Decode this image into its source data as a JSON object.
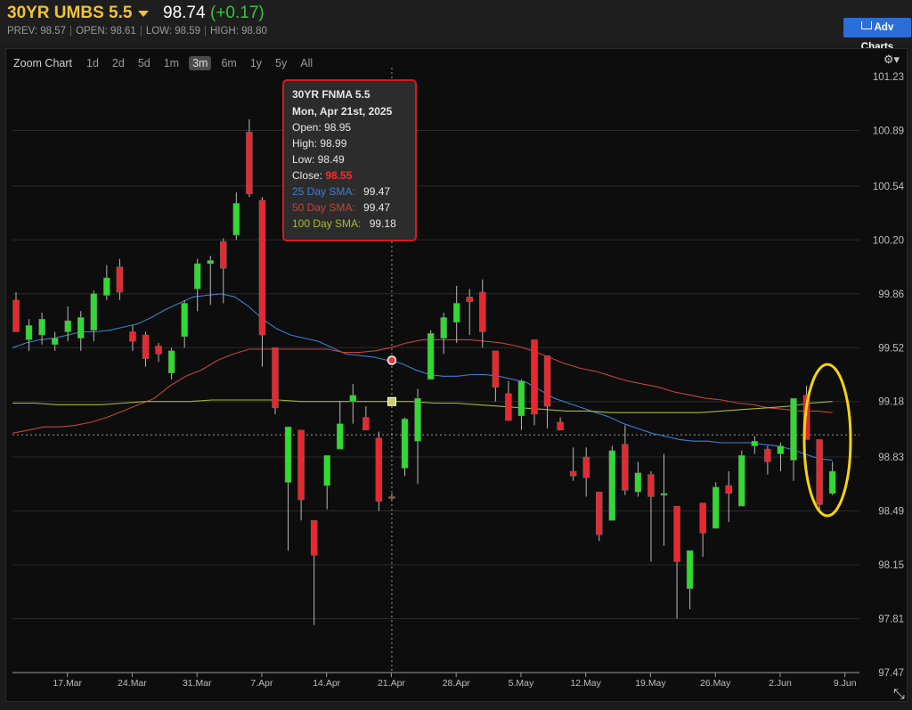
{
  "header": {
    "title": "30YR UMBS 5.5",
    "price": "98.74",
    "change": "(+0.17)",
    "prev": "PREV: 98.57",
    "open": "OPEN: 98.61",
    "low": "LOW: 98.59",
    "high": "HIGH: 98.80",
    "adv_charts_label": "Adv Charts"
  },
  "toolbar": {
    "zoom_label": "Zoom Chart",
    "ranges": [
      "1d",
      "2d",
      "5d",
      "1m",
      "3m",
      "6m",
      "1y",
      "5y",
      "All"
    ],
    "active_range": "3m",
    "settings_icon": "gear-icon"
  },
  "tooltip": {
    "instrument": "30YR FNMA 5.5",
    "date": "Mon, Apr 21st, 2025",
    "open": "Open: 98.95",
    "high": "High: 98.99",
    "low": "Low: 98.49",
    "close_label": "Close:",
    "close_value": "98.55",
    "sma25_label": "25 Day SMA:",
    "sma25_value": "99.47",
    "sma50_label": "50 Day SMA:",
    "sma50_value": "99.47",
    "sma100_label": "100 Day SMA:",
    "sma100_value": "99.18"
  },
  "colors": {
    "up": "#2fdb2f",
    "down": "#e8282e",
    "sma25": "#3d7fcf",
    "sma50": "#c0443e",
    "sma100": "#a9b83a",
    "highlight_ellipse": "#f5d40f",
    "title": "#f0c23c"
  },
  "chart_data": {
    "type": "candlestick",
    "y_ticks": [
      "101.23",
      "100.89",
      "100.54",
      "100.20",
      "99.86",
      "99.52",
      "99.18",
      "98.83",
      "98.49",
      "98.15",
      "97.81",
      "97.47"
    ],
    "x_ticks": [
      "17.Mar",
      "24.Mar",
      "31.Mar",
      "7.Apr",
      "14.Apr",
      "21.Apr",
      "28.Apr",
      "5.May",
      "12.May",
      "19.May",
      "26.May",
      "2.Jun",
      "9.Jun"
    ],
    "ylim": [
      97.47,
      101.23
    ],
    "grid": true,
    "crosshair_value": 98.97,
    "candles": [
      {
        "open": 99.82,
        "close": 99.62,
        "high": 99.87,
        "low": 99.62
      },
      {
        "open": 99.57,
        "close": 99.66,
        "high": 99.7,
        "low": 99.5
      },
      {
        "open": 99.6,
        "close": 99.7,
        "high": 99.74,
        "low": 99.54
      },
      {
        "open": 99.54,
        "close": 99.58,
        "high": 99.62,
        "low": 99.5
      },
      {
        "open": 99.62,
        "close": 99.69,
        "high": 99.78,
        "low": 99.56
      },
      {
        "open": 99.58,
        "close": 99.71,
        "high": 99.75,
        "low": 99.5
      },
      {
        "open": 99.63,
        "close": 99.86,
        "high": 99.88,
        "low": 99.56
      },
      {
        "open": 99.85,
        "close": 99.96,
        "high": 100.04,
        "low": 99.82
      },
      {
        "open": 100.03,
        "close": 99.87,
        "high": 100.08,
        "low": 99.82
      },
      {
        "open": 99.62,
        "close": 99.56,
        "high": 99.66,
        "low": 99.5
      },
      {
        "open": 99.6,
        "close": 99.45,
        "high": 99.62,
        "low": 99.4
      },
      {
        "open": 99.53,
        "close": 99.48,
        "high": 99.55,
        "low": 99.43
      },
      {
        "open": 99.36,
        "close": 99.5,
        "high": 99.52,
        "low": 99.32
      },
      {
        "open": 99.59,
        "close": 99.8,
        "high": 99.82,
        "low": 99.52
      },
      {
        "open": 99.89,
        "close": 100.05,
        "high": 100.08,
        "low": 99.75
      },
      {
        "open": 100.05,
        "close": 100.07,
        "high": 100.1,
        "low": 99.79
      },
      {
        "open": 100.19,
        "close": 100.02,
        "high": 100.21,
        "low": 99.8
      },
      {
        "open": 100.23,
        "close": 100.43,
        "high": 100.5,
        "low": 100.2
      },
      {
        "open": 100.88,
        "close": 100.49,
        "high": 100.96,
        "low": 100.47
      },
      {
        "open": 100.45,
        "close": 99.6,
        "high": 100.47,
        "low": 99.4
      },
      {
        "open": 99.52,
        "close": 99.14,
        "high": 99.52,
        "low": 99.1
      },
      {
        "open": 98.67,
        "close": 99.02,
        "high": 99.02,
        "low": 98.24
      },
      {
        "open": 99.0,
        "close": 98.56,
        "high": 99.0,
        "low": 98.43
      },
      {
        "open": 98.43,
        "close": 98.21,
        "high": 98.43,
        "low": 97.77
      },
      {
        "open": 98.65,
        "close": 98.84,
        "high": 98.84,
        "low": 98.5
      },
      {
        "open": 98.88,
        "close": 99.04,
        "high": 99.18,
        "low": 98.88
      },
      {
        "open": 99.18,
        "close": 99.22,
        "high": 99.29,
        "low": 99.04
      },
      {
        "open": 99.08,
        "close": 99.0,
        "high": 99.15,
        "low": 99.0
      },
      {
        "open": 98.95,
        "close": 98.55,
        "high": 98.99,
        "low": 98.49
      },
      {
        "open": 98.58,
        "close": 98.57,
        "high": 98.6,
        "low": 98.56
      },
      {
        "open": 98.76,
        "close": 99.07,
        "high": 99.08,
        "low": 98.71
      },
      {
        "open": 98.93,
        "close": 99.2,
        "high": 99.26,
        "low": 98.66
      },
      {
        "open": 99.32,
        "close": 99.61,
        "high": 99.63,
        "low": 99.32
      },
      {
        "open": 99.58,
        "close": 99.71,
        "high": 99.74,
        "low": 99.48
      },
      {
        "open": 99.68,
        "close": 99.8,
        "high": 99.91,
        "low": 99.55
      },
      {
        "open": 99.84,
        "close": 99.81,
        "high": 99.89,
        "low": 99.6
      },
      {
        "open": 99.87,
        "close": 99.62,
        "high": 99.95,
        "low": 99.52
      },
      {
        "open": 99.5,
        "close": 99.27,
        "high": 99.5,
        "low": 99.18
      },
      {
        "open": 99.23,
        "close": 99.06,
        "high": 99.31,
        "low": 99.06
      },
      {
        "open": 99.09,
        "close": 99.31,
        "high": 99.32,
        "low": 99.0
      },
      {
        "open": 99.57,
        "close": 99.1,
        "high": 99.57,
        "low": 99.03
      },
      {
        "open": 99.47,
        "close": 99.15,
        "high": 99.47,
        "low": 99.01
      },
      {
        "open": 99.05,
        "close": 99.0,
        "high": 99.08,
        "low": 99.0
      },
      {
        "open": 98.74,
        "close": 98.71,
        "high": 98.89,
        "low": 98.68
      },
      {
        "open": 98.83,
        "close": 98.7,
        "high": 98.89,
        "low": 98.58
      },
      {
        "open": 98.61,
        "close": 98.34,
        "high": 98.61,
        "low": 98.3
      },
      {
        "open": 98.43,
        "close": 98.87,
        "high": 98.9,
        "low": 98.43
      },
      {
        "open": 98.91,
        "close": 98.62,
        "high": 99.03,
        "low": 98.59
      },
      {
        "open": 98.61,
        "close": 98.73,
        "high": 98.8,
        "low": 98.58
      },
      {
        "open": 98.72,
        "close": 98.58,
        "high": 98.74,
        "low": 98.17
      },
      {
        "open": 98.59,
        "close": 98.6,
        "high": 98.85,
        "low": 98.27
      },
      {
        "open": 98.52,
        "close": 98.17,
        "high": 98.52,
        "low": 97.81
      },
      {
        "open": 98.0,
        "close": 98.24,
        "high": 98.24,
        "low": 97.87
      },
      {
        "open": 98.54,
        "close": 98.35,
        "high": 98.54,
        "low": 98.2
      },
      {
        "open": 98.38,
        "close": 98.64,
        "high": 98.67,
        "low": 98.38
      },
      {
        "open": 98.65,
        "close": 98.6,
        "high": 98.74,
        "low": 98.42
      },
      {
        "open": 98.52,
        "close": 98.84,
        "high": 98.87,
        "low": 98.52
      },
      {
        "open": 98.9,
        "close": 98.93,
        "high": 98.96,
        "low": 98.85
      },
      {
        "open": 98.88,
        "close": 98.8,
        "high": 98.9,
        "low": 98.72
      },
      {
        "open": 98.85,
        "close": 98.9,
        "high": 98.92,
        "low": 98.74
      },
      {
        "open": 98.81,
        "close": 99.2,
        "high": 99.2,
        "low": 98.68
      },
      {
        "open": 99.22,
        "close": 98.94,
        "high": 99.28,
        "low": 98.94
      },
      {
        "open": 98.94,
        "close": 98.53,
        "high": 98.94,
        "low": 98.49
      },
      {
        "open": 98.6,
        "close": 98.74,
        "high": 98.8,
        "low": 98.59
      }
    ],
    "series": [
      {
        "name": "25 Day SMA",
        "values": [
          99.52,
          99.55,
          99.57,
          99.58,
          99.6,
          99.62,
          99.62,
          99.63,
          99.65,
          99.67,
          99.71,
          99.76,
          99.8,
          99.84,
          99.85,
          99.86,
          99.84,
          99.78,
          99.7,
          99.64,
          99.6,
          99.58,
          99.56,
          99.52,
          99.48,
          99.47,
          99.46,
          99.44,
          99.42,
          99.38,
          99.35,
          99.34,
          99.34,
          99.35,
          99.35,
          99.34,
          99.32,
          99.3,
          99.25,
          99.2,
          99.17,
          99.14,
          99.11,
          99.08,
          99.04,
          99.01,
          98.98,
          98.96,
          98.94,
          98.93,
          98.93,
          98.92,
          98.92,
          98.92,
          98.91,
          98.9,
          98.88,
          98.85,
          98.82,
          98.81
        ]
      },
      {
        "name": "50 Day SMA",
        "values": [
          98.98,
          99.0,
          99.02,
          99.02,
          99.03,
          99.05,
          99.08,
          99.12,
          99.16,
          99.2,
          99.28,
          99.34,
          99.38,
          99.44,
          99.48,
          99.51,
          99.51,
          99.51,
          99.51,
          99.51,
          99.51,
          99.49,
          99.49,
          99.5,
          99.52,
          99.55,
          99.57,
          99.57,
          99.57,
          99.57,
          99.56,
          99.55,
          99.53,
          99.5,
          99.46,
          99.42,
          99.39,
          99.37,
          99.34,
          99.31,
          99.29,
          99.27,
          99.24,
          99.22,
          99.2,
          99.19,
          99.17,
          99.16,
          99.14,
          99.13,
          99.12,
          99.12,
          99.11
        ]
      },
      {
        "name": "100 Day SMA",
        "values": [
          99.17,
          99.17,
          99.16,
          99.16,
          99.16,
          99.17,
          99.18,
          99.18,
          99.18,
          99.19,
          99.19,
          99.19,
          99.19,
          99.18,
          99.18,
          99.18,
          99.18,
          99.18,
          99.18,
          99.17,
          99.17,
          99.16,
          99.15,
          99.14,
          99.13,
          99.12,
          99.12,
          99.11,
          99.11,
          99.11,
          99.11,
          99.11,
          99.12,
          99.13,
          99.14,
          99.15,
          99.17,
          99.18
        ]
      }
    ]
  }
}
